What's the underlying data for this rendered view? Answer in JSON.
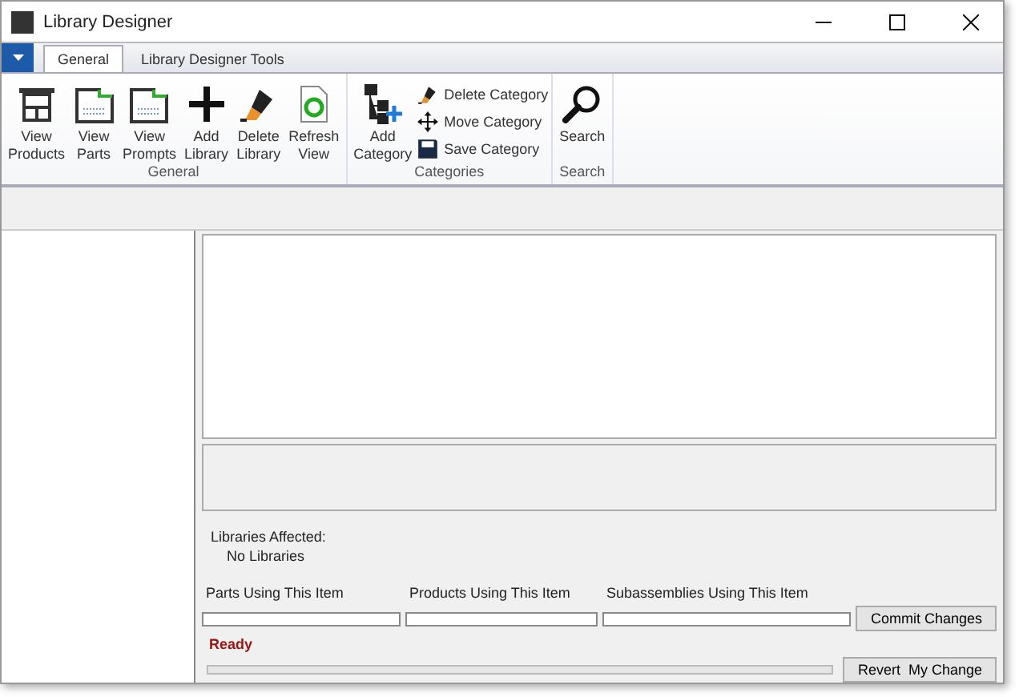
{
  "window": {
    "title": "Library Designer"
  },
  "tabs": [
    {
      "label": "General",
      "selected": true
    },
    {
      "label": "Library Designer Tools",
      "selected": false
    }
  ],
  "ribbon_groups": [
    {
      "label": "General",
      "buttons": [
        {
          "label": "View\nProducts",
          "kind": "cabinet"
        },
        {
          "label": "View\nParts",
          "kind": "part"
        },
        {
          "label": "View\nPrompts",
          "kind": "part"
        },
        {
          "label": "Add\nLibrary",
          "kind": "plus"
        },
        {
          "label": "Delete\nLibrary",
          "kind": "eraser"
        },
        {
          "label": "Refresh\nView",
          "kind": "refresh"
        }
      ]
    },
    {
      "label": "Categories",
      "buttons": [
        {
          "label": "Add\nCategory",
          "kind": "tree"
        }
      ],
      "small_buttons": [
        {
          "label": "Delete Category",
          "kind": "eraser"
        },
        {
          "label": "Move Category",
          "kind": "move"
        },
        {
          "label": "Save Category",
          "kind": "save"
        }
      ]
    },
    {
      "label": "Search",
      "buttons": [
        {
          "label": "Search",
          "kind": "search"
        }
      ]
    }
  ],
  "details": {
    "libraries_label": "Libraries Affected:",
    "libraries_value": "No Libraries",
    "fields": [
      {
        "label": "Parts Using This Item"
      },
      {
        "label": "Products Using This Item"
      },
      {
        "label": "Subassemblies Using This Item"
      }
    ],
    "status": "Ready",
    "progress": {
      "level": 0
    },
    "buttons": [
      "Commit Changes",
      "Revert  My Change"
    ]
  }
}
